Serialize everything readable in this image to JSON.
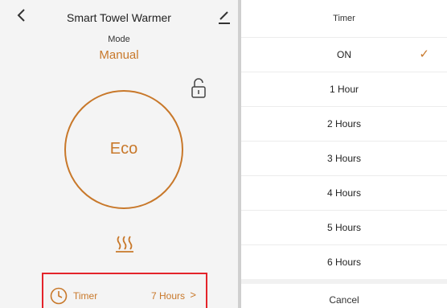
{
  "left_panel": {
    "title": "Smart Towel Warmer",
    "back_icon": "chevron-left-icon",
    "edit_icon": "pencil-icon",
    "mode_label": "Mode",
    "mode_value": "Manual",
    "lock_icon": "unlock-icon",
    "dial_text": "Eco",
    "heat_icon": "heat-waves-icon",
    "timer": {
      "icon": "clock-icon",
      "label": "Timer",
      "value": "7 Hours",
      "chevron": ">"
    }
  },
  "timer_sheet": {
    "title": "Timer",
    "options": [
      {
        "label": "ON",
        "selected": true
      },
      {
        "label": "1 Hour",
        "selected": false
      },
      {
        "label": "2 Hours",
        "selected": false
      },
      {
        "label": "3 Hours",
        "selected": false
      },
      {
        "label": "4 Hours",
        "selected": false
      },
      {
        "label": "5 Hours",
        "selected": false
      },
      {
        "label": "6 Hours",
        "selected": false
      }
    ],
    "check_mark": "✓",
    "cancel_label": "Cancel"
  },
  "colors": {
    "accent": "#c8782a",
    "highlight_border": "#e4242b",
    "left_background": "#f4f4f4",
    "sheet_background": "#ffffff"
  }
}
